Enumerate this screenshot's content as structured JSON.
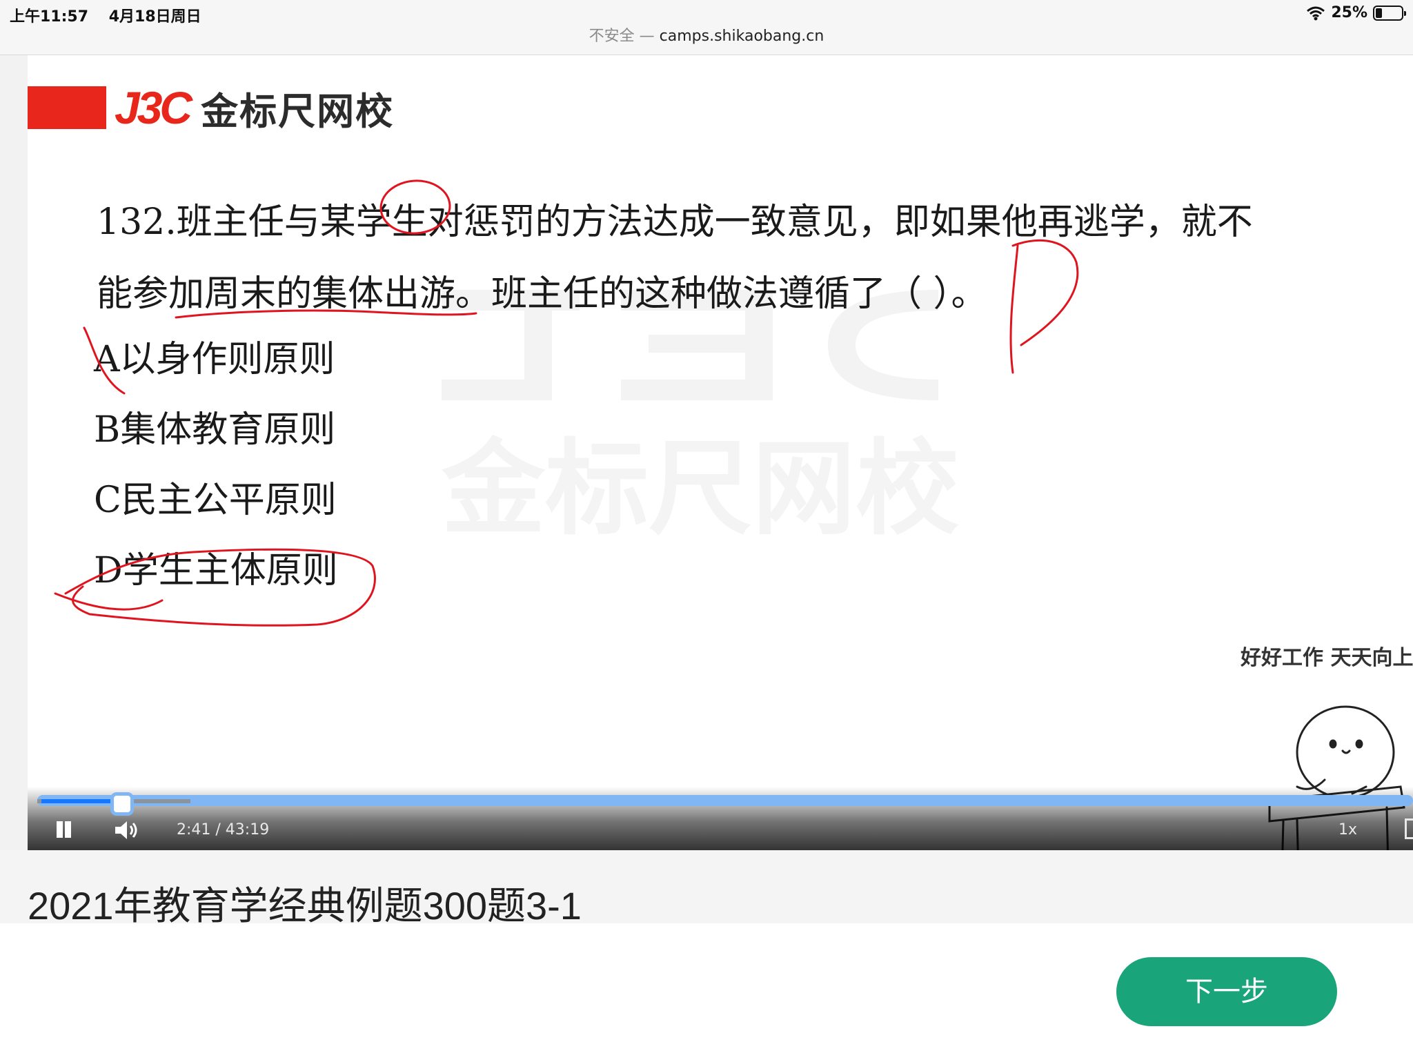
{
  "status_bar": {
    "time": "上午11:57",
    "date": "4月18日周日",
    "battery": "25%"
  },
  "url_bar": {
    "insecure_label": "不安全 —",
    "domain": "camps.shikaobang.cn"
  },
  "video": {
    "logo": {
      "brand_letters": "J3C",
      "brand_name": "金标尺网校"
    },
    "question": {
      "line1": "132.班主任与某学生对惩罚的方法达成一致意见，即如果他再逃学，就不",
      "line2": "能参加周末的集体出游。班主任的这种做法遵循了（    ）。"
    },
    "options": [
      {
        "label": "A以身作则原则"
      },
      {
        "label": "B集体教育原则"
      },
      {
        "label": "C民主公平原则"
      },
      {
        "label": "D学生主体原则"
      }
    ],
    "handwritten_answer": "D",
    "sticker_caption": "好好工作 天天向上",
    "controls": {
      "time": "2:41 / 43:19",
      "speed": "1x",
      "progress": 0.0619
    }
  },
  "page": {
    "title": "2021年教育学经典例题300题3-1",
    "next_button": "下一步"
  },
  "colors": {
    "brand_red": "#e8261c",
    "annotation_red": "#e0141e",
    "progress_blue": "#7fb6f3",
    "button_green": "#1aa47a"
  }
}
